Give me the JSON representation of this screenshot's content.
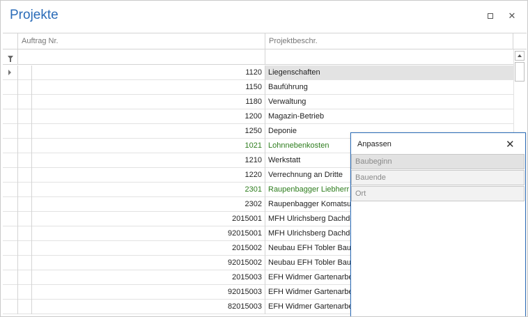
{
  "window": {
    "title": "Projekte",
    "maximize_icon": "maximize-icon",
    "close_icon": "close-icon"
  },
  "grid": {
    "columns": [
      {
        "label": "Auftrag Nr."
      },
      {
        "label": "Projektbeschr."
      }
    ],
    "filter_icon": "filter-icon",
    "rows": [
      {
        "nr": "1120",
        "desc": "Liegenschaften",
        "selected": true,
        "green": false
      },
      {
        "nr": "1150",
        "desc": "Bauführung",
        "selected": false,
        "green": false
      },
      {
        "nr": "1180",
        "desc": "Verwaltung",
        "selected": false,
        "green": false
      },
      {
        "nr": "1200",
        "desc": "Magazin-Betrieb",
        "selected": false,
        "green": false
      },
      {
        "nr": "1250",
        "desc": "Deponie",
        "selected": false,
        "green": false
      },
      {
        "nr": "1021",
        "desc": "Lohnnebenkosten",
        "selected": false,
        "green": true
      },
      {
        "nr": "1210",
        "desc": "Werkstatt",
        "selected": false,
        "green": false
      },
      {
        "nr": "1220",
        "desc": "Verrechnung an Dritte",
        "selected": false,
        "green": false
      },
      {
        "nr": "2301",
        "desc": "Raupenbagger Liebherr L",
        "selected": false,
        "green": true
      },
      {
        "nr": "2302",
        "desc": "Raupenbagger Komatsu",
        "selected": false,
        "green": false
      },
      {
        "nr": "2015001",
        "desc": "MFH Ulrichsberg Dachdec",
        "selected": false,
        "green": false
      },
      {
        "nr": "92015001",
        "desc": "MFH Ulrichsberg Dachdec",
        "selected": false,
        "green": false
      },
      {
        "nr": "2015002",
        "desc": "Neubau EFH Tobler Baum",
        "selected": false,
        "green": false
      },
      {
        "nr": "92015002",
        "desc": "Neubau EFH Tobler Baum",
        "selected": false,
        "green": false
      },
      {
        "nr": "2015003",
        "desc": "EFH Widmer Gartenarbe",
        "selected": false,
        "green": false
      },
      {
        "nr": "92015003",
        "desc": "EFH Widmer Gartenarbe",
        "selected": false,
        "green": false
      },
      {
        "nr": "82015003",
        "desc": "EFH Widmer Gartenarbe",
        "selected": false,
        "green": false
      }
    ]
  },
  "customize": {
    "title": "Anpassen",
    "close_icon": "close-icon",
    "items": [
      {
        "label": "Baubeginn",
        "highlighted": true
      },
      {
        "label": "Bauende",
        "highlighted": false
      },
      {
        "label": "Ort",
        "highlighted": false
      }
    ]
  }
}
